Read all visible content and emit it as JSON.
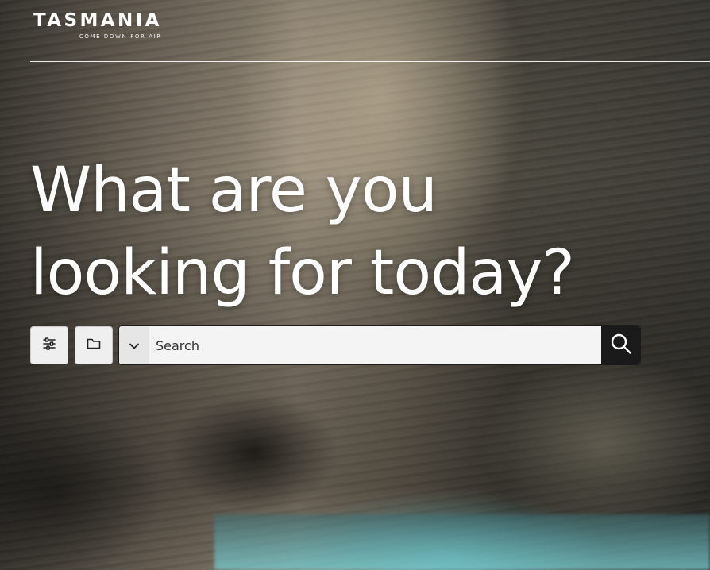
{
  "header": {
    "logo_text": "TASMANIA",
    "logo_tagline": "COME DOWN FOR AIR"
  },
  "hero": {
    "headline_line1": "What are you",
    "headline_line2": "looking for today?"
  },
  "toolbar": {
    "filter_icon": "sliders-icon",
    "folder_icon": "folder-icon"
  },
  "search": {
    "scope_icon": "chevron-down-icon",
    "placeholder": "Search",
    "value": "",
    "submit_icon": "search-icon"
  },
  "colors": {
    "search_button": "#1a1a1a",
    "tool_button": "#efefef",
    "text_on_hero": "#ffffff"
  }
}
